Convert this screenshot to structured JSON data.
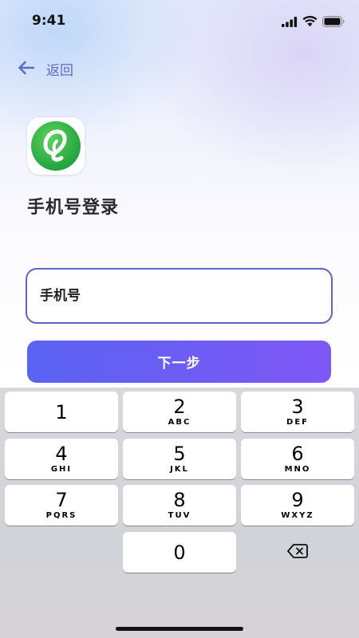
{
  "status_bar": {
    "time": "9:41"
  },
  "nav": {
    "back_label": "返回"
  },
  "header": {
    "title": "手机号登录"
  },
  "form": {
    "phone_placeholder": "手机号",
    "phone_value": "",
    "next_label": "下一步"
  },
  "keyboard": {
    "keys": [
      {
        "digit": "1",
        "letters": ""
      },
      {
        "digit": "2",
        "letters": "ABC"
      },
      {
        "digit": "3",
        "letters": "DEF"
      },
      {
        "digit": "4",
        "letters": "GHI"
      },
      {
        "digit": "5",
        "letters": "JKL"
      },
      {
        "digit": "6",
        "letters": "MNO"
      },
      {
        "digit": "7",
        "letters": "PQRS"
      },
      {
        "digit": "8",
        "letters": "TUV"
      },
      {
        "digit": "9",
        "letters": "WXYZ"
      },
      {
        "digit": "0",
        "letters": ""
      }
    ],
    "delete_icon": "backspace-icon"
  },
  "icons": {
    "back": "arrow-left-icon",
    "signal": "cellular-signal-icon",
    "wifi": "wifi-icon",
    "battery": "battery-icon",
    "logo": "app-logo-icon"
  },
  "colors": {
    "accent": "#5e62c2",
    "button_start": "#5a63f2",
    "button_end": "#7e57f5",
    "logo_green": "#2fb34a"
  }
}
